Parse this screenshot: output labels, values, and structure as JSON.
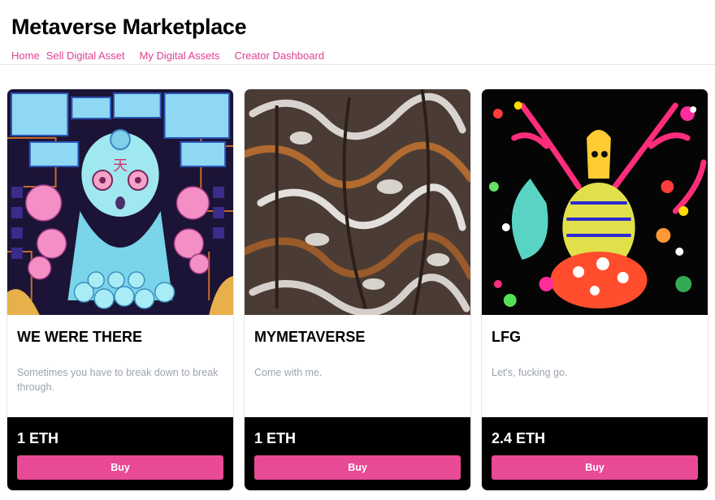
{
  "site": {
    "title": "Metaverse Marketplace"
  },
  "nav": [
    {
      "label": "Home"
    },
    {
      "label": "Sell Digital Asset"
    },
    {
      "label": "My Digital Assets"
    },
    {
      "label": "Creator Dashboard"
    }
  ],
  "listings": [
    {
      "name": "WE WERE THERE",
      "description": "Sometimes you have to break down to break through.",
      "price": "1 ETH",
      "buy_label": "Buy"
    },
    {
      "name": "MYMETAVERSE",
      "description": "Come with me.",
      "price": "1 ETH",
      "buy_label": "Buy"
    },
    {
      "name": "LFG",
      "description": "Let's, fucking go.",
      "price": "2.4 ETH",
      "buy_label": "Buy"
    }
  ],
  "colors": {
    "accent": "#e94a96",
    "link": "#e0418f",
    "footer_bg": "#000000",
    "description": "#9ca3af"
  }
}
